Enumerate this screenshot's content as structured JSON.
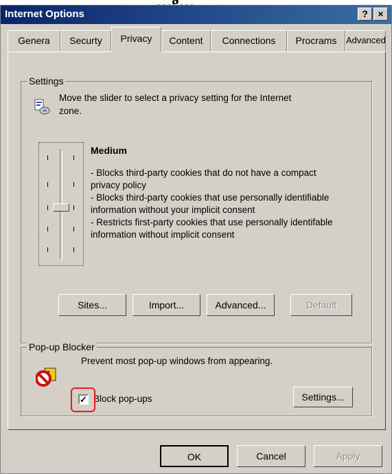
{
  "top_heading": "…g…",
  "window": {
    "title": "Internet Options",
    "help_label": "?",
    "close_label": "×"
  },
  "tabs": [
    "Genera",
    "Securty",
    "Privacy",
    "Content",
    "Connections",
    "Procrams",
    "Advanced"
  ],
  "settings": {
    "legend": "Settings",
    "intro_line1": "Move the slider to select a privacy setting for the Internet",
    "intro_line2": "zone.",
    "level_title": "Medium",
    "desc_lines": [
      "- Blocks third-party cookies that do not have a compact",
      "privacy policy",
      "- Blocks third-party cookies that use personally identifiable",
      "information without your implicit consent",
      "- Restricts first-party cookies that use personally identifable",
      "information without implicit consent"
    ],
    "slider_level": "Medium",
    "buttons": {
      "sites": "Sites...",
      "import": "Import...",
      "advanced": "Advanced...",
      "default": "Default"
    }
  },
  "popup": {
    "legend": "Pop-up Blocker",
    "description": "Prevent most pop-up windows from appearing.",
    "checkbox_label": "Block pop-ups",
    "checked": true,
    "settings_button": "Settings..."
  },
  "footer": {
    "ok": "OK",
    "cancel": "Cancel",
    "apply": "Apply"
  }
}
